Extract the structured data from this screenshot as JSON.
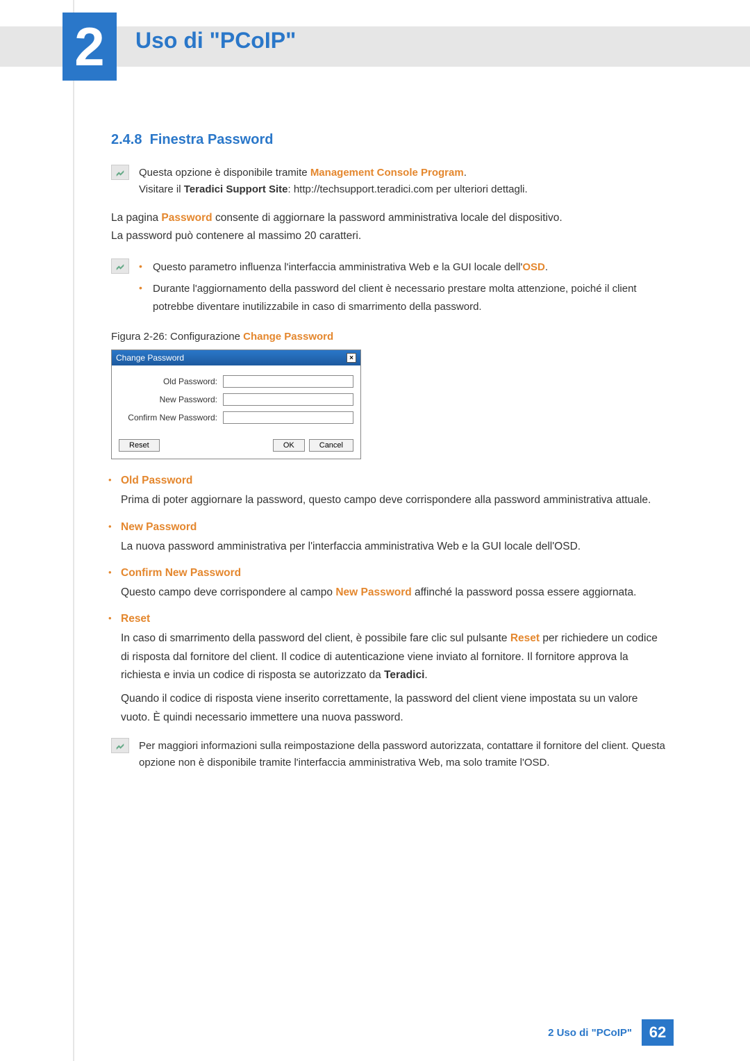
{
  "chapter": {
    "number": "2",
    "title": "Uso di \"PCoIP\""
  },
  "section": {
    "number": "2.4.8",
    "title": "Finestra Password"
  },
  "note1": {
    "line1a": "Questa opzione è disponibile tramite ",
    "line1b": "Management Console Program",
    "line1c": ".",
    "line2a": "Visitare il ",
    "line2b": "Teradici Support Site",
    "line2c": ": http://techsupport.teradici.com per ulteriori dettagli."
  },
  "para1a": "La pagina ",
  "para1b": "Password",
  "para1c": " consente di aggiornare la password amministrativa locale del dispositivo.",
  "para2": "La password può contenere al massimo 20 caratteri.",
  "note2": {
    "b1a": "Questo parametro influenza l'interfaccia amministrativa Web e la GUI locale dell'",
    "b1b": "OSD",
    "b1c": ".",
    "b2": "Durante l'aggiornamento della password del client è necessario prestare molta attenzione, poiché il client potrebbe diventare inutilizzabile in caso di smarrimento della password."
  },
  "figure": {
    "prefix": "Figura 2-26: Configurazione ",
    "name": "Change Password"
  },
  "dialog": {
    "title": "Change Password",
    "old": "Old Password:",
    "new": "New Password:",
    "confirm": "Confirm New Password:",
    "reset": "Reset",
    "ok": "OK",
    "cancel": "Cancel"
  },
  "fields": {
    "old": {
      "title": "Old Password",
      "desc": "Prima di poter aggiornare la password, questo campo deve corrispondere alla password amministrativa attuale."
    },
    "new": {
      "title": "New Password",
      "desc": "La nuova password amministrativa per l'interfaccia amministrativa Web e la GUI locale dell'OSD."
    },
    "confirm": {
      "title": "Confirm New Password",
      "d1": "Questo campo deve corrispondere al campo ",
      "d2": "New Password",
      "d3": " affinché la password possa essere aggiornata."
    },
    "reset": {
      "title": "Reset",
      "p1a": "In caso di smarrimento della password del client, è possibile fare clic sul pulsante ",
      "p1b": "Reset",
      "p1c": " per richiedere un codice di risposta dal fornitore del client. Il codice di autenticazione viene inviato al fornitore. Il fornitore approva la richiesta e invia un codice di risposta se autorizzato da ",
      "p1d": "Teradici",
      "p1e": ".",
      "p2": "Quando il codice di risposta viene inserito correttamente, la password del client viene impostata su un valore vuoto. È quindi necessario immettere una nuova password."
    }
  },
  "note3": "Per maggiori informazioni sulla reimpostazione della password autorizzata, contattare il fornitore del client. Questa opzione non è disponibile tramite l'interfaccia amministrativa Web, ma solo tramite l'OSD.",
  "footer": {
    "text": "2 Uso di \"PCoIP\"",
    "page": "62"
  }
}
